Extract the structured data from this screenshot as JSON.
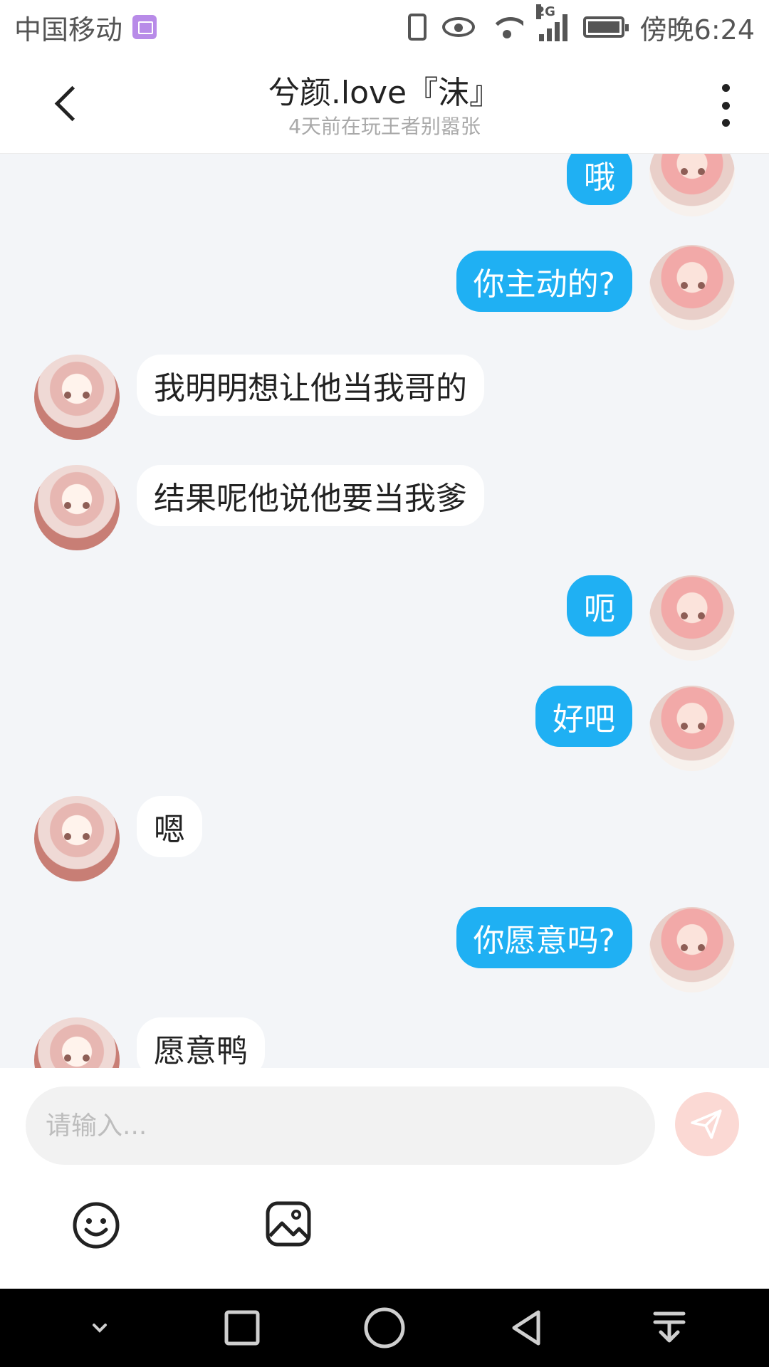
{
  "status_bar": {
    "carrier": "中国移动",
    "network_type": "2G",
    "time": "傍晚6:24",
    "battery_level": 1.0,
    "icons": [
      "gallery-notification-icon",
      "vibrate-icon",
      "eye-comfort-icon",
      "wifi-icon",
      "signal-icon",
      "battery-icon"
    ]
  },
  "header": {
    "title": "兮颜.love『沫』",
    "subtitle": "4天前在玩王者别嚣张",
    "icons": [
      "back-arrow-icon",
      "more-options-icon"
    ]
  },
  "messages": [
    {
      "from": "me",
      "text": "哦"
    },
    {
      "from": "me",
      "text": "你主动的?"
    },
    {
      "from": "peer",
      "text": "我明明想让他当我哥的"
    },
    {
      "from": "peer",
      "text": "结果呢他说他要当我爹"
    },
    {
      "from": "me",
      "text": "呃"
    },
    {
      "from": "me",
      "text": "好吧"
    },
    {
      "from": "peer",
      "text": "嗯"
    },
    {
      "from": "me",
      "text": "你愿意吗?"
    },
    {
      "from": "peer",
      "text": "愿意鸭"
    }
  ],
  "composer": {
    "placeholder": "请输入...",
    "value": "",
    "icons": [
      "send-icon",
      "emoji-icon",
      "image-icon"
    ]
  },
  "colors": {
    "outgoing_bubble": "#1fb0f3",
    "incoming_bubble": "#ffffff",
    "chat_background": "#f3f5f8",
    "send_button": "#fbd9d4"
  },
  "nav_bar": {
    "icons": [
      "hide-keyboard-icon",
      "recents-icon",
      "home-icon",
      "back-icon",
      "notification-drawer-icon"
    ]
  }
}
